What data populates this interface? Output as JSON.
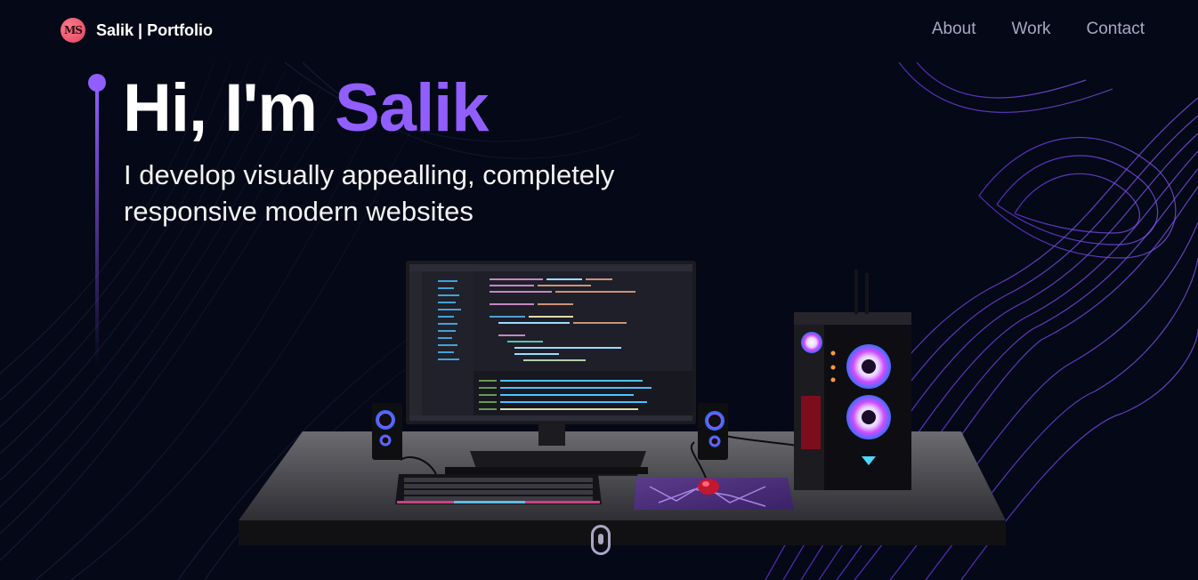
{
  "nav": {
    "logo_initials": "MS",
    "logo_text": "Salik | Portfolio",
    "links": [
      {
        "label": "About"
      },
      {
        "label": "Work"
      },
      {
        "label": "Contact"
      }
    ]
  },
  "hero": {
    "title_prefix": "Hi, I'm ",
    "title_name": "Salik",
    "subtitle": "I develop visually appealling, completely responsive modern websites"
  },
  "colors": {
    "background": "#050816",
    "accent": "#915eff",
    "nav_text": "#aaa6c3",
    "logo_badge": "#e0455e"
  },
  "icons": {
    "logo": "ms-logo-icon",
    "scroll": "mouse-scroll-icon"
  }
}
